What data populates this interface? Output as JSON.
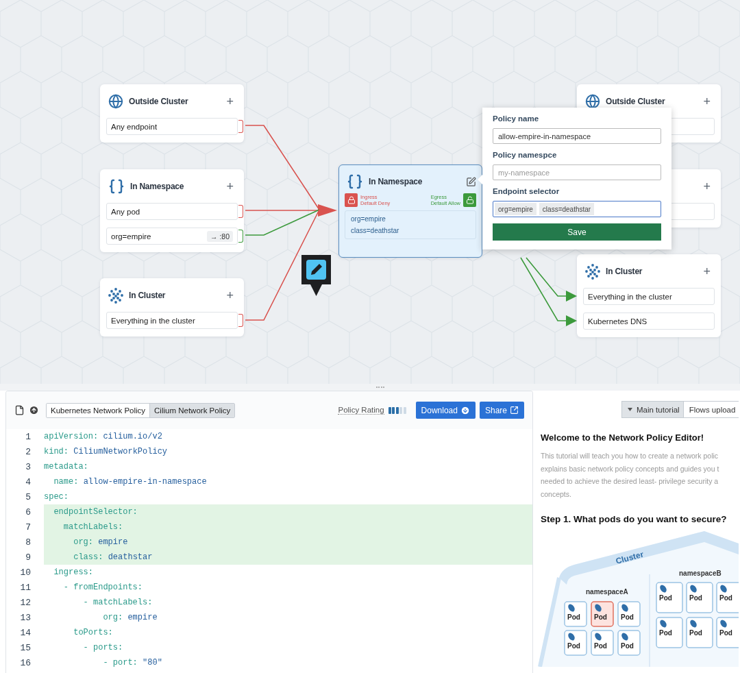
{
  "canvas": {
    "left_nodes": [
      {
        "kind": "world",
        "title": "Outside Cluster",
        "add": "+",
        "rules": [
          {
            "label": "Any endpoint",
            "allowed": false
          }
        ]
      },
      {
        "kind": "namespace",
        "title": "In Namespace",
        "add": "+",
        "rules": [
          {
            "label": "Any pod",
            "allowed": false
          },
          {
            "label": "org=empire",
            "port": "→ :80",
            "allowed": true
          }
        ]
      },
      {
        "kind": "cluster",
        "title": "In Cluster",
        "add": "+",
        "rules": [
          {
            "label": "Everything in the cluster",
            "allowed": false
          }
        ]
      }
    ],
    "center_node": {
      "kind": "namespace",
      "title": "In Namespace",
      "selected": true,
      "ingress": {
        "label": "Ingress",
        "policy": "Default Deny",
        "default_deny": true
      },
      "egress": {
        "label": "Egress",
        "policy": "Default Allow",
        "default_deny": false
      },
      "labels": [
        "org=empire",
        "class=deathstar"
      ]
    },
    "right_nodes": [
      {
        "kind": "world",
        "title": "Outside Cluster",
        "add": "+",
        "rules": [
          {
            "kind": "blank"
          }
        ]
      },
      {
        "add": "+",
        "rules": [
          {
            "kind": "blank"
          }
        ]
      },
      {
        "kind": "cluster",
        "title": "In Cluster",
        "add": "+",
        "rules": [
          {
            "kind": "text",
            "label": "Everything in the cluster",
            "allowed": true
          },
          {
            "kind": "text",
            "label": "Kubernetes DNS",
            "allowed": true
          }
        ]
      }
    ],
    "popover": {
      "fields": [
        {
          "kind": "text",
          "label": "Policy name",
          "value": "allow-empire-in-namespace",
          "focused": false
        },
        {
          "kind": "text",
          "label": "Policy namespce",
          "placeholder": "my-namespace",
          "focused": false
        },
        {
          "kind": "chips",
          "label": "Endpoint selector",
          "chips": [
            "org=empire",
            "class=deathstar"
          ],
          "focused": true
        }
      ],
      "save": "Save"
    }
  },
  "editor": {
    "policy_types": [
      {
        "label": "Kubernetes Network Policy",
        "selected": false
      },
      {
        "label": "Cilium Network Policy",
        "selected": true
      }
    ],
    "rating": {
      "label": "Policy Rating",
      "level": 0.6
    },
    "download": "Download",
    "share": "Share",
    "lines": [
      {
        "number": "1",
        "key": "apiVersion:",
        "value": "cilium.io/v2",
        "highlighted": false
      },
      {
        "number": "2",
        "key": "kind:",
        "value": "CiliumNetworkPolicy",
        "highlighted": false
      },
      {
        "number": "3",
        "key": "metadata:",
        "highlighted": false
      },
      {
        "number": "4",
        "key": "  name:",
        "value": "allow-empire-in-namespace",
        "highlighted": false
      },
      {
        "number": "5",
        "key": "spec:",
        "highlighted": false
      },
      {
        "number": "6",
        "key": "  endpointSelector:",
        "highlighted": true
      },
      {
        "number": "7",
        "key": "    matchLabels:",
        "highlighted": true
      },
      {
        "number": "8",
        "key": "      org:",
        "value": "empire",
        "highlighted": true
      },
      {
        "number": "9",
        "key": "      class:",
        "value": "deathstar",
        "highlighted": true
      },
      {
        "number": "10",
        "key": "  ingress:",
        "highlighted": false
      },
      {
        "number": "11",
        "key": "    - fromEndpoints:",
        "highlighted": false
      },
      {
        "number": "12",
        "key": "        - matchLabels:",
        "highlighted": false
      },
      {
        "number": "13",
        "key": "            org:",
        "value": "empire",
        "highlighted": false
      },
      {
        "number": "14",
        "key": "      toPorts:",
        "highlighted": false
      },
      {
        "number": "15",
        "key": "        - ports:",
        "highlighted": false
      },
      {
        "number": "16",
        "key": "            - port:",
        "value": "\"80\"",
        "highlighted": false
      }
    ]
  },
  "tutorial": {
    "tabs": [
      {
        "label": "Main tutorial",
        "selected": true
      },
      {
        "label": "Flows upload",
        "selected": false
      }
    ],
    "title": "Welcome to the Network Policy Editor!",
    "intro_lines": [
      "This tutorial will teach you how to create a network polic",
      "explains basic network policy concepts and guides you t",
      "needed to achieve the desired least- privilege security a",
      "concepts."
    ],
    "step": "Step 1. What pods do you want to secure?",
    "illustration": {
      "cluster": "Cluster",
      "namespaces": [
        {
          "name": "namespaceA",
          "pods": [
            {
              "label": "Pod",
              "highlighted": false
            },
            {
              "label": "Pod",
              "highlighted": true
            },
            {
              "label": "Pod",
              "highlighted": false
            },
            {
              "label": "Pod",
              "highlighted": false
            },
            {
              "label": "Pod",
              "highlighted": false
            },
            {
              "label": "Pod",
              "highlighted": false
            }
          ]
        },
        {
          "name": "namespaceB",
          "pods": [
            {
              "label": "Pod",
              "highlighted": false
            },
            {
              "label": "Pod",
              "highlighted": false
            },
            {
              "label": "Pod",
              "highlighted": false
            },
            {
              "label": "Pod",
              "highlighted": false
            },
            {
              "label": "Pod",
              "highlighted": false
            },
            {
              "label": "Pod",
              "highlighted": false
            }
          ]
        }
      ]
    }
  }
}
